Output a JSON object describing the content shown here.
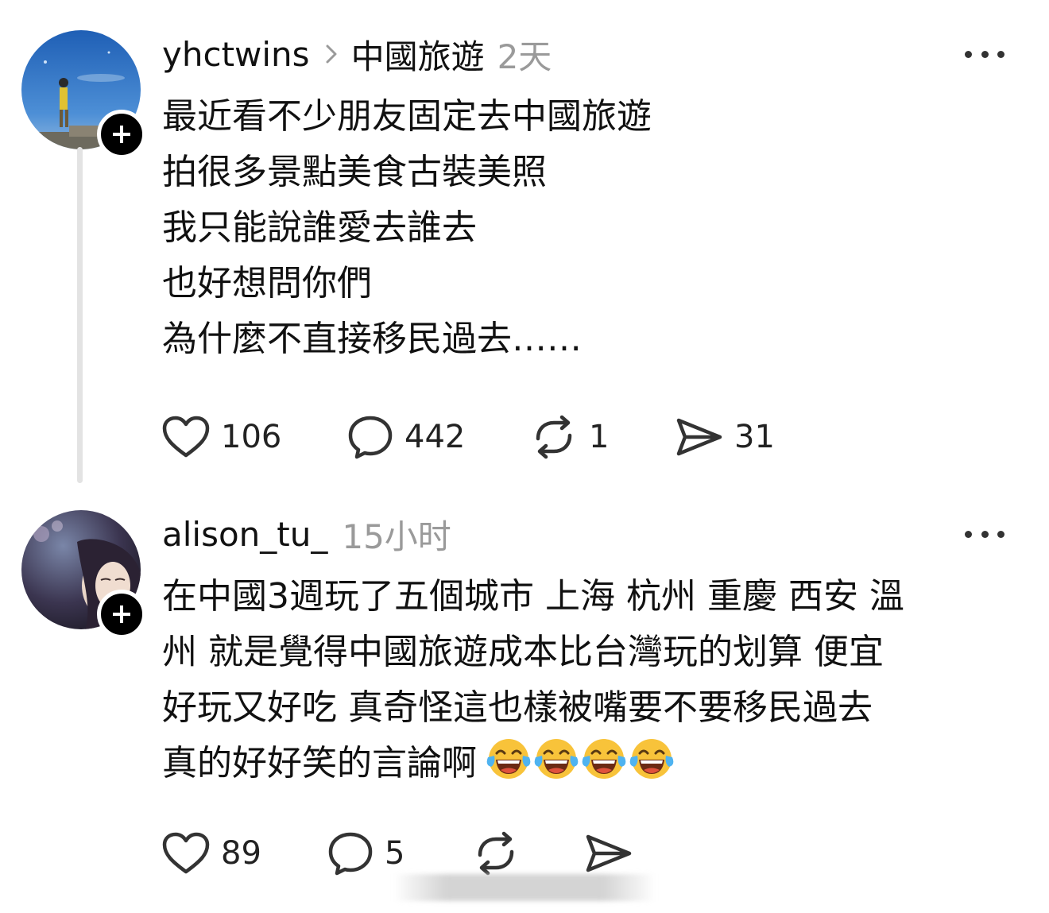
{
  "posts": [
    {
      "username": "yhctwins",
      "topic": "中國旅遊",
      "time": "2天",
      "body": [
        "最近看不少朋友固定去中國旅遊",
        "拍很多景點美食古裝美照",
        "我只能說誰愛去誰去",
        "也好想問你們",
        "為什麼不直接移民過去……"
      ],
      "likes": "106",
      "comments": "442",
      "reposts": "1",
      "shares": "31"
    },
    {
      "username": "alison_tu_",
      "time": "15小时",
      "body": [
        "在中國3週玩了五個城市  上海 杭州 重慶 西安 溫",
        "州 就是覺得中國旅遊成本比台灣玩的划算 便宜",
        "好玩又好吃 真奇怪這也樣被嘴要不要移民過去",
        "真的好好笑的言論啊"
      ],
      "emoji": "face-with-tears-of-joy",
      "emoji_count": 4,
      "likes": "89",
      "comments": "5"
    }
  ],
  "colors": {
    "text": "#111111",
    "muted": "#9a9a9a",
    "thread_line": "#e3e3e3",
    "icon": "#333333"
  }
}
